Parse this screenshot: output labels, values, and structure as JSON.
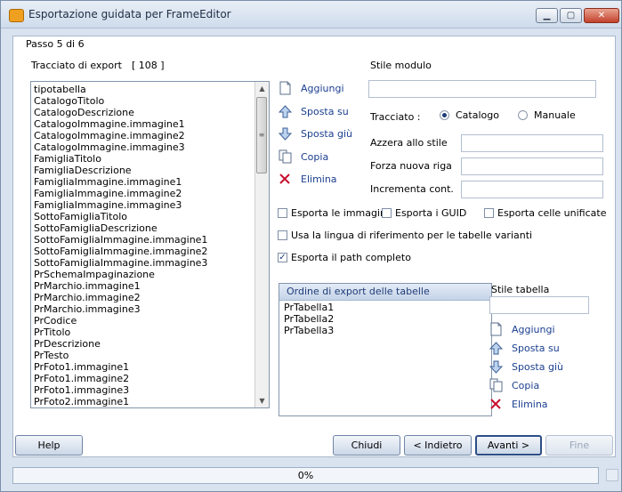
{
  "window": {
    "title": "Esportazione guidata per FrameEditor"
  },
  "step": {
    "label": "Passo 5 di 6"
  },
  "tracciato": {
    "label": "Tracciato di export",
    "count": "[ 108 ]",
    "items": [
      "tipotabella",
      "CatalogoTitolo",
      "CatalogoDescrizione",
      "CatalogoImmagine.immagine1",
      "CatalogoImmagine.immagine2",
      "CatalogoImmagine.immagine3",
      "FamigliaTitolo",
      "FamigliaDescrizione",
      "FamigliaImmagine.immagine1",
      "FamigliaImmagine.immagine2",
      "FamigliaImmagine.immagine3",
      "SottoFamigliaTitolo",
      "SottoFamigliaDescrizione",
      "SottoFamigliaImmagine.immagine1",
      "SottoFamigliaImmagine.immagine2",
      "SottoFamigliaImmagine.immagine3",
      "PrSchemaImpaginazione",
      "PrMarchio.immagine1",
      "PrMarchio.immagine2",
      "PrMarchio.immagine3",
      "PrCodice",
      "PrTitolo",
      "PrDescrizione",
      "PrTesto",
      "PrFoto1.immagine1",
      "PrFoto1.immagine2",
      "PrFoto1.immagine3",
      "PrFoto2.immagine1"
    ]
  },
  "actions1": {
    "aggiungi": "Aggiungi",
    "sposta_su": "Sposta su",
    "sposta_giu": "Sposta giù",
    "copia": "Copia",
    "elimina": "Elimina"
  },
  "stile_modulo": {
    "label": "Stile modulo",
    "value": ""
  },
  "tracciato_type": {
    "label": "Tracciato :",
    "option1": "Catalogo",
    "option2": "Manuale",
    "selected": "Catalogo"
  },
  "fields": {
    "azzera": "Azzera allo stile",
    "forza": "Forza nuova riga",
    "incrementa": "Incrementa cont."
  },
  "checks": {
    "immagini": "Esporta le immagini",
    "guid": "Esporta i GUID",
    "celle": "Esporta celle unificate",
    "lingua": "Usa la lingua di riferimento per le tabelle varianti",
    "path": "Esporta il path completo"
  },
  "ordine": {
    "title": "Ordine di export delle tabelle",
    "items": [
      "PrTabella1",
      "PrTabella2",
      "PrTabella3"
    ]
  },
  "stile_tabella": {
    "label": "Stile tabella",
    "value": ""
  },
  "actions2": {
    "aggiungi": "Aggiungi",
    "sposta_su": "Sposta su",
    "sposta_giu": "Sposta giù",
    "copia": "Copia",
    "elimina": "Elimina"
  },
  "buttons": {
    "help": "Help",
    "chiudi": "Chiudi",
    "indietro": "< Indietro",
    "avanti": "Avanti >",
    "fine": "Fine"
  },
  "progress": {
    "text": "0%",
    "value": 0
  },
  "colors": {
    "accent": "#1b3f8f",
    "delete": "#c8102e",
    "titlebar": "#dbe5f1"
  }
}
